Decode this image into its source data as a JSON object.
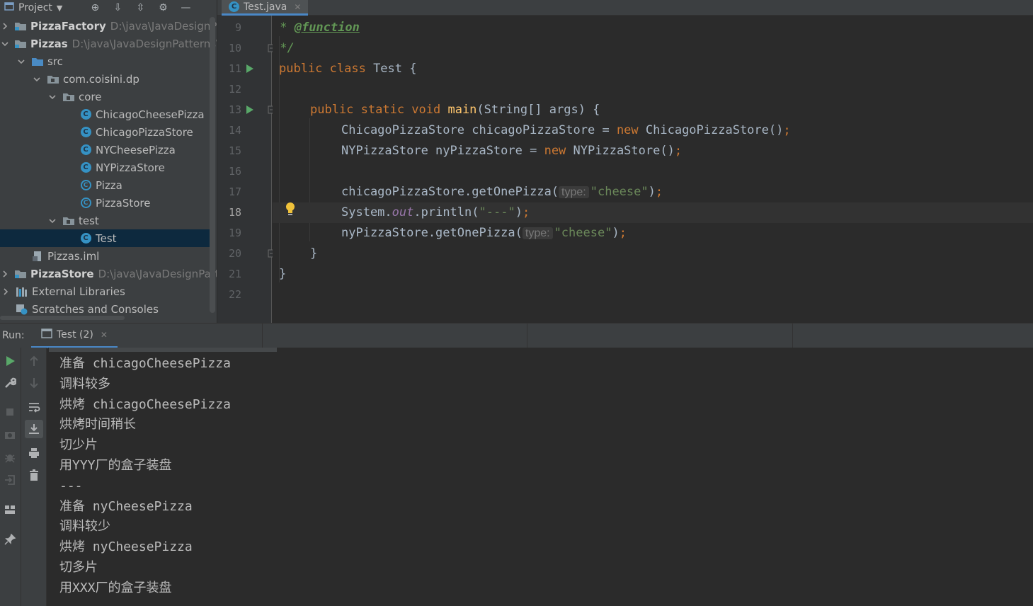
{
  "project_panel": {
    "title": "Project",
    "tree": [
      {
        "label": "PizzaFactory",
        "path": "D:\\java\\JavaDesignPat",
        "bold": true,
        "arrow": "right",
        "icon": "module-folder-icon",
        "indent": 0
      },
      {
        "label": "Pizzas",
        "path": "D:\\java\\JavaDesignPatterns\\D",
        "bold": true,
        "arrow": "down",
        "icon": "module-folder-icon",
        "indent": 0
      },
      {
        "label": "src",
        "arrow": "down",
        "icon": "source-folder-icon",
        "indent": 1
      },
      {
        "label": "com.coisini.dp",
        "arrow": "down",
        "icon": "package-icon",
        "indent": 2
      },
      {
        "label": "core",
        "arrow": "down",
        "icon": "package-icon",
        "indent": 3
      },
      {
        "label": "ChicagoCheesePizza",
        "arrow": "none",
        "icon": "class-icon",
        "indent": 4
      },
      {
        "label": "ChicagoPizzaStore",
        "arrow": "none",
        "icon": "class-icon",
        "indent": 4
      },
      {
        "label": "NYCheesePizza",
        "arrow": "none",
        "icon": "class-icon",
        "indent": 4
      },
      {
        "label": "NYPizzaStore",
        "arrow": "none",
        "icon": "class-icon",
        "indent": 4
      },
      {
        "label": "Pizza",
        "arrow": "none",
        "icon": "abstract-class-icon",
        "indent": 4
      },
      {
        "label": "PizzaStore",
        "arrow": "none",
        "icon": "abstract-class-icon",
        "indent": 4
      },
      {
        "label": "test",
        "arrow": "down",
        "icon": "package-icon",
        "indent": 3
      },
      {
        "label": "Test",
        "arrow": "none",
        "icon": "runnable-class-icon",
        "indent": 4,
        "selected": true
      },
      {
        "label": "Pizzas.iml",
        "arrow": "none",
        "icon": "iml-file-icon",
        "indent": 1
      },
      {
        "label": "PizzaStore",
        "path": "D:\\java\\JavaDesignPatte",
        "bold": true,
        "arrow": "right",
        "icon": "module-folder-icon",
        "indent": 0
      },
      {
        "label": "External Libraries",
        "arrow": "right",
        "icon": "libraries-icon",
        "indent": 0
      },
      {
        "label": "Scratches and Consoles",
        "arrow": "none",
        "icon": "scratches-icon",
        "indent": 0
      }
    ]
  },
  "editor": {
    "tab_label": "Test.java",
    "current_line": 18,
    "line_numbers": [
      "9",
      "10",
      "11",
      "12",
      "13",
      "14",
      "15",
      "16",
      "17",
      "18",
      "19",
      "20",
      "21",
      "22"
    ],
    "code": {
      "l9_star": " * ",
      "l9_tag": "@function",
      "l10": " */",
      "l11_kw": "public class ",
      "l11_name": "Test {",
      "l13_kw": "public static void ",
      "l13_fn": "main",
      "l13_rest": "(String[] args) {",
      "l14_a": "ChicagoPizzaStore chicagoPizzaStore = ",
      "l14_kw": "new ",
      "l14_b": "ChicagoPizzaStore()",
      "l14_semi": ";",
      "l15_a": "NYPizzaStore nyPizzaStore = ",
      "l15_kw": "new ",
      "l15_b": "NYPizzaStore()",
      "l15_semi": ";",
      "l17_a": "chicagoPizzaStore.getOnePizza(",
      "l17_hint": "type:",
      "l17_str": "\"cheese\"",
      "l17_b": ")",
      "l17_semi": ";",
      "l18_a": "System.",
      "l18_out": "out",
      "l18_b": ".println(",
      "l18_str": "\"---\"",
      "l18_c": ")",
      "l18_semi": ";",
      "l19_a": "nyPizzaStore.getOnePizza(",
      "l19_hint": "type:",
      "l19_str": "\"cheese\"",
      "l19_b": ")",
      "l19_semi": ";",
      "l20": "}",
      "l21": "}"
    }
  },
  "run_panel": {
    "label": "Run:",
    "tab_label": "Test (2)",
    "output": [
      "准备 chicagoCheesePizza",
      "调料较多",
      "烘烤 chicagoCheesePizza",
      "烘烤时间稍长",
      "切少片",
      "用YYY厂的盒子装盘",
      "---",
      "准备 nyCheesePizza",
      "调料较少",
      "烘烤 nyCheesePizza",
      "切多片",
      "用XXX厂的盒子装盘"
    ]
  },
  "colors": {
    "keyword": "#cc7832",
    "string": "#6a8759",
    "function": "#ffc66d",
    "static_field": "#9876aa",
    "doc_comment": "#629755",
    "selection": "#0d293e",
    "accent": "#4a88c7"
  }
}
